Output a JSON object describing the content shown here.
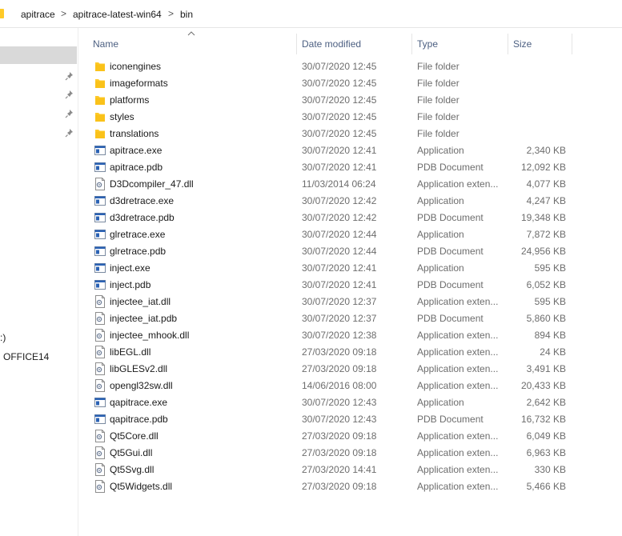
{
  "breadcrumbs": [
    "apitrace",
    "apitrace-latest-win64",
    "bin"
  ],
  "breadcrumb_separator": ">",
  "nav": {
    "drive_fragment": ":)",
    "item_label": "OFFICE14"
  },
  "columns": {
    "name": "Name",
    "date": "Date modified",
    "type": "Type",
    "size": "Size"
  },
  "files": [
    {
      "name": "iconengines",
      "date": "30/07/2020 12:45",
      "type": "File folder",
      "size": "",
      "icon": "folder-icon"
    },
    {
      "name": "imageformats",
      "date": "30/07/2020 12:45",
      "type": "File folder",
      "size": "",
      "icon": "folder-icon"
    },
    {
      "name": "platforms",
      "date": "30/07/2020 12:45",
      "type": "File folder",
      "size": "",
      "icon": "folder-icon"
    },
    {
      "name": "styles",
      "date": "30/07/2020 12:45",
      "type": "File folder",
      "size": "",
      "icon": "folder-icon"
    },
    {
      "name": "translations",
      "date": "30/07/2020 12:45",
      "type": "File folder",
      "size": "",
      "icon": "folder-icon"
    },
    {
      "name": "apitrace.exe",
      "date": "30/07/2020 12:41",
      "type": "Application",
      "size": "2,340 KB",
      "icon": "application-icon"
    },
    {
      "name": "apitrace.pdb",
      "date": "30/07/2020 12:41",
      "type": "PDB Document",
      "size": "12,092 KB",
      "icon": "application-icon"
    },
    {
      "name": "D3Dcompiler_47.dll",
      "date": "11/03/2014 06:24",
      "type": "Application exten...",
      "size": "4,077 KB",
      "icon": "dll-icon"
    },
    {
      "name": "d3dretrace.exe",
      "date": "30/07/2020 12:42",
      "type": "Application",
      "size": "4,247 KB",
      "icon": "application-icon"
    },
    {
      "name": "d3dretrace.pdb",
      "date": "30/07/2020 12:42",
      "type": "PDB Document",
      "size": "19,348 KB",
      "icon": "application-icon"
    },
    {
      "name": "glretrace.exe",
      "date": "30/07/2020 12:44",
      "type": "Application",
      "size": "7,872 KB",
      "icon": "application-icon"
    },
    {
      "name": "glretrace.pdb",
      "date": "30/07/2020 12:44",
      "type": "PDB Document",
      "size": "24,956 KB",
      "icon": "application-icon"
    },
    {
      "name": "inject.exe",
      "date": "30/07/2020 12:41",
      "type": "Application",
      "size": "595 KB",
      "icon": "application-icon"
    },
    {
      "name": "inject.pdb",
      "date": "30/07/2020 12:41",
      "type": "PDB Document",
      "size": "6,052 KB",
      "icon": "application-icon"
    },
    {
      "name": "injectee_iat.dll",
      "date": "30/07/2020 12:37",
      "type": "Application exten...",
      "size": "595 KB",
      "icon": "dll-icon"
    },
    {
      "name": "injectee_iat.pdb",
      "date": "30/07/2020 12:37",
      "type": "PDB Document",
      "size": "5,860 KB",
      "icon": "dll-icon"
    },
    {
      "name": "injectee_mhook.dll",
      "date": "30/07/2020 12:38",
      "type": "Application exten...",
      "size": "894 KB",
      "icon": "dll-icon"
    },
    {
      "name": "libEGL.dll",
      "date": "27/03/2020 09:18",
      "type": "Application exten...",
      "size": "24 KB",
      "icon": "dll-icon"
    },
    {
      "name": "libGLESv2.dll",
      "date": "27/03/2020 09:18",
      "type": "Application exten...",
      "size": "3,491 KB",
      "icon": "dll-icon"
    },
    {
      "name": "opengl32sw.dll",
      "date": "14/06/2016 08:00",
      "type": "Application exten...",
      "size": "20,433 KB",
      "icon": "dll-icon"
    },
    {
      "name": "qapitrace.exe",
      "date": "30/07/2020 12:43",
      "type": "Application",
      "size": "2,642 KB",
      "icon": "application-icon"
    },
    {
      "name": "qapitrace.pdb",
      "date": "30/07/2020 12:43",
      "type": "PDB Document",
      "size": "16,732 KB",
      "icon": "application-icon"
    },
    {
      "name": "Qt5Core.dll",
      "date": "27/03/2020 09:18",
      "type": "Application exten...",
      "size": "6,049 KB",
      "icon": "dll-icon"
    },
    {
      "name": "Qt5Gui.dll",
      "date": "27/03/2020 09:18",
      "type": "Application exten...",
      "size": "6,963 KB",
      "icon": "dll-icon"
    },
    {
      "name": "Qt5Svg.dll",
      "date": "27/03/2020 14:41",
      "type": "Application exten...",
      "size": "330 KB",
      "icon": "dll-icon"
    },
    {
      "name": "Qt5Widgets.dll",
      "date": "27/03/2020 09:18",
      "type": "Application exten...",
      "size": "5,466 KB",
      "icon": "dll-icon"
    }
  ],
  "colors": {
    "folder": "#ffca28",
    "folder_shade": "#f0b400",
    "header_text": "#4d6082",
    "secondary_text": "#6d6d6d",
    "app_icon_blue": "#2b62b4"
  }
}
